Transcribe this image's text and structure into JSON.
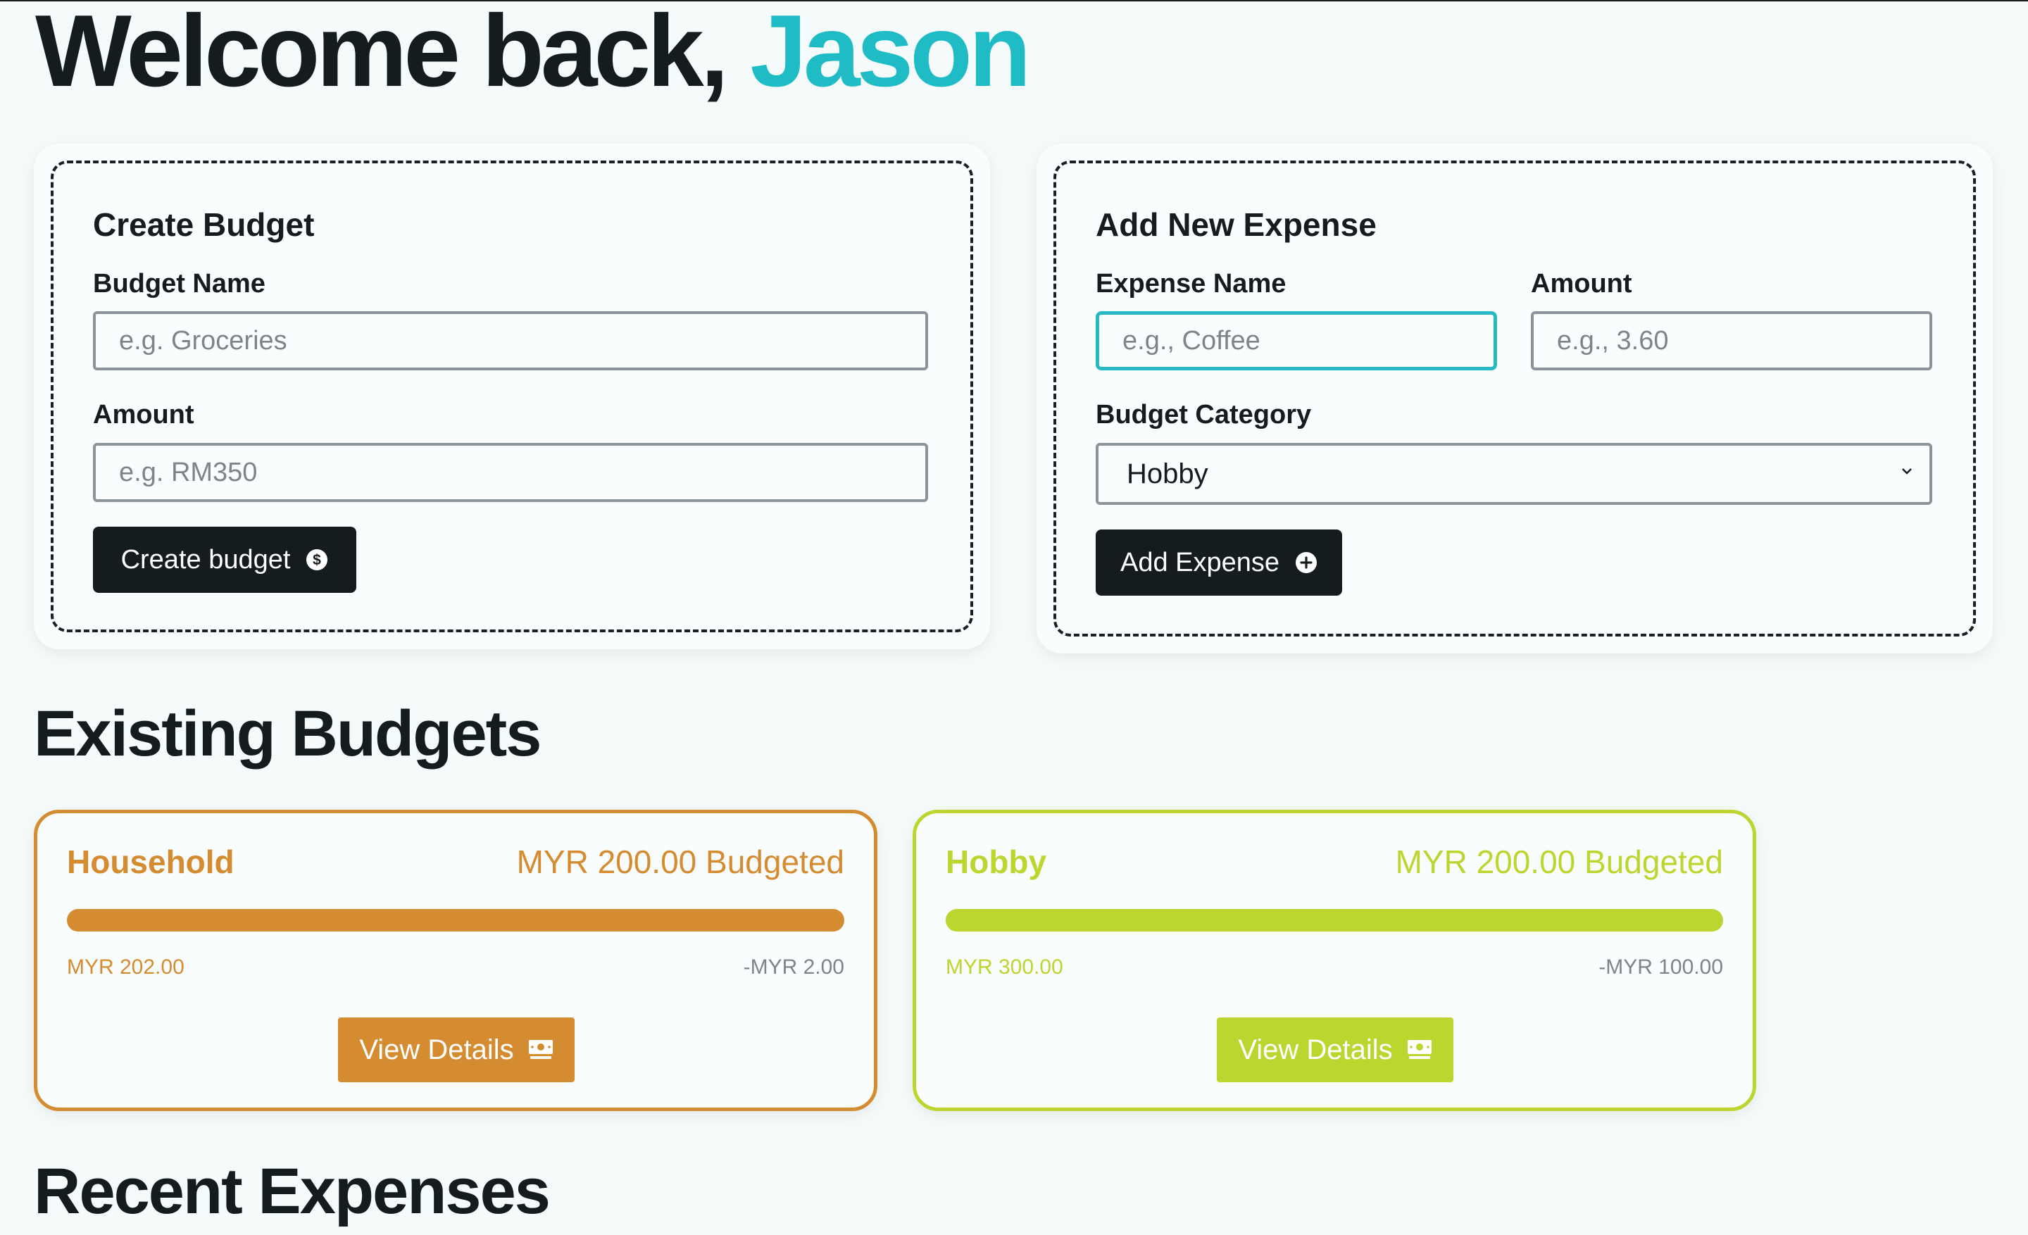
{
  "header": {
    "welcome_prefix": "Welcome back,",
    "user_name": "Jason",
    "accent_color": "#1fbcc6"
  },
  "create_budget": {
    "title": "Create Budget",
    "name_label": "Budget Name",
    "name_placeholder": "e.g. Groceries",
    "amount_label": "Amount",
    "amount_placeholder": "e.g. RM350",
    "button_label": "Create budget",
    "button_icon": "dollar-circle-icon"
  },
  "add_expense": {
    "title": "Add New Expense",
    "name_label": "Expense Name",
    "name_placeholder": "e.g., Coffee",
    "amount_label": "Amount",
    "amount_placeholder": "e.g., 3.60",
    "category_label": "Budget Category",
    "category_selected": "Hobby",
    "button_label": "Add Expense",
    "button_icon": "plus-circle-icon"
  },
  "existing_budgets": {
    "title": "Existing Budgets",
    "items": [
      {
        "name": "Household",
        "budgeted": "MYR 200.00 Budgeted",
        "spent": "MYR 202.00",
        "remaining": "-MYR 2.00",
        "progress": 1.0,
        "color": "#d58b2f",
        "button_label": "View Details",
        "button_icon": "cash-icon"
      },
      {
        "name": "Hobby",
        "budgeted": "MYR 200.00 Budgeted",
        "spent": "MYR 300.00",
        "remaining": "-MYR 100.00",
        "progress": 1.0,
        "color": "#bcd52f",
        "button_label": "View Details",
        "button_icon": "cash-icon"
      }
    ]
  },
  "recent_expenses": {
    "title": "Recent Expenses"
  }
}
